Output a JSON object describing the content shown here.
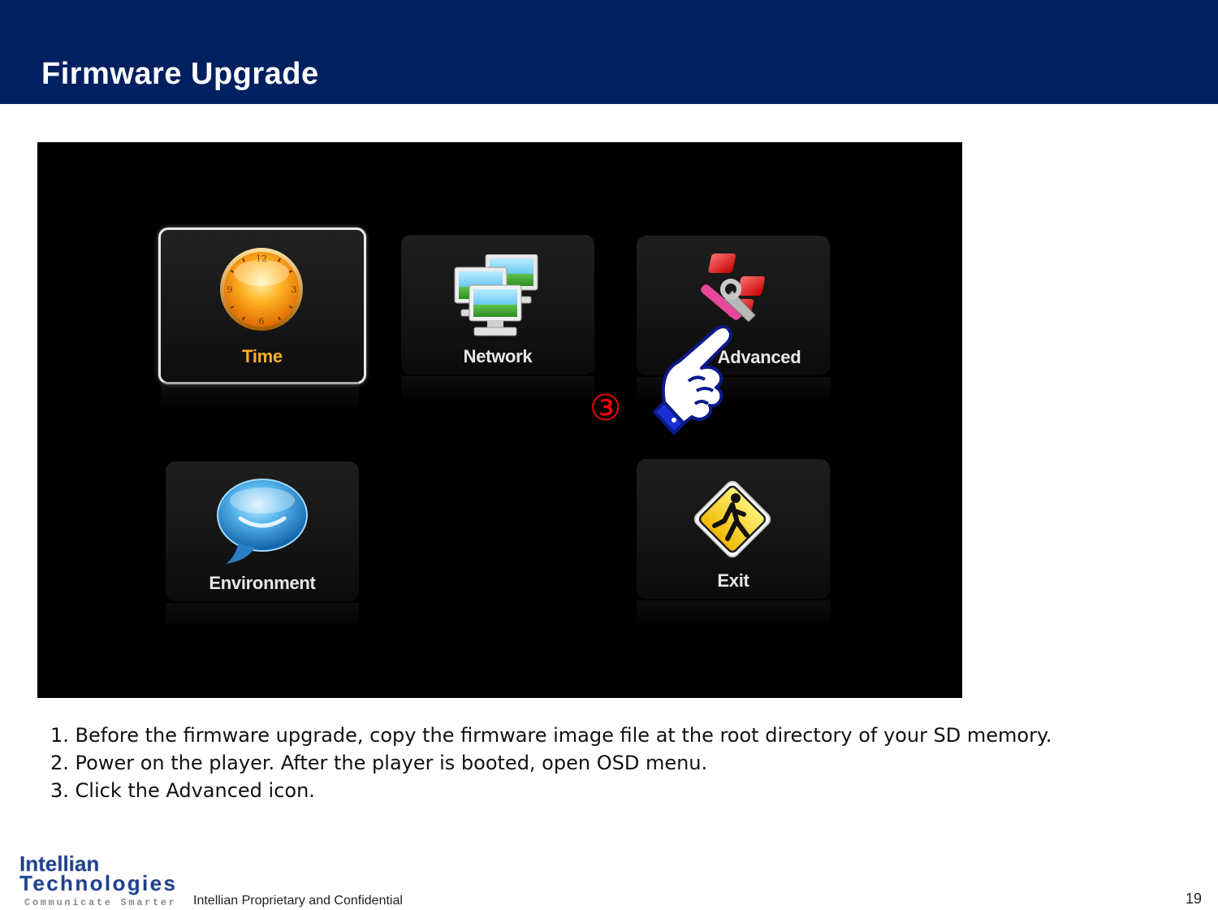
{
  "slide": {
    "title": "Firmware Upgrade",
    "colors": {
      "header": "#002060",
      "marker": "#ff0000"
    }
  },
  "osd": {
    "selected": "Time",
    "tiles": [
      {
        "label": "Time",
        "icon": "clock-icon"
      },
      {
        "label": "Network",
        "icon": "network-icon"
      },
      {
        "label": "Advanced",
        "icon": "tools-icon"
      },
      {
        "label": "Environment",
        "icon": "speech-bubble-icon"
      },
      {
        "label": "Exit",
        "icon": "exit-sign-icon"
      }
    ]
  },
  "annotation": {
    "marker": "③",
    "icon": "pointing-hand-icon"
  },
  "instructions": [
    "1. Before the firmware upgrade, copy the firmware image file at the root directory of your SD memory.",
    "2. Power on the player. After the player is booted, open OSD menu.",
    "3. Click the Advanced icon."
  ],
  "footer": {
    "logo_line1": "Intellian",
    "logo_line2": "Technologies",
    "logo_tagline": "Communicate Smarter",
    "confidential": "Intellian Proprietary and Confidential",
    "page_number": "19"
  }
}
